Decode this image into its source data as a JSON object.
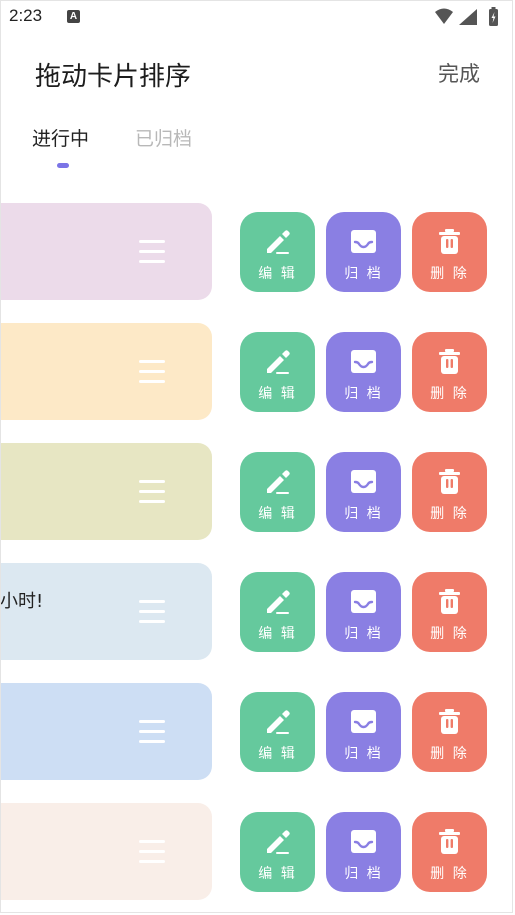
{
  "status_bar": {
    "time": "2:23",
    "notification_glyph": "A"
  },
  "header": {
    "title": "拖动卡片排序",
    "done_label": "完成"
  },
  "tabs": [
    {
      "label": "进行中",
      "active": true
    },
    {
      "label": "已归档",
      "active": false
    }
  ],
  "actions": {
    "edit_label": "编 辑",
    "archive_label": "归 档",
    "delete_label": "删 除"
  },
  "cards": [
    {
      "text": "",
      "color": "#ecdbea"
    },
    {
      "text": "",
      "color": "#fde9c7"
    },
    {
      "text": "",
      "color": "#e7e6c3"
    },
    {
      "text": "小时!",
      "color": "#dce8f1"
    },
    {
      "text": "",
      "color": "#cddef4"
    },
    {
      "text": "",
      "color": "#f9eee8"
    }
  ],
  "colors": {
    "edit": "#65c99d",
    "archive": "#8a7fe3",
    "delete": "#ef7b69",
    "tab_indicator": "#7b74e6"
  },
  "icons": {
    "edit": "pencil-icon",
    "archive": "inbox-tray-icon",
    "delete": "trash-can-icon",
    "handle": "drag-handle-icon"
  }
}
